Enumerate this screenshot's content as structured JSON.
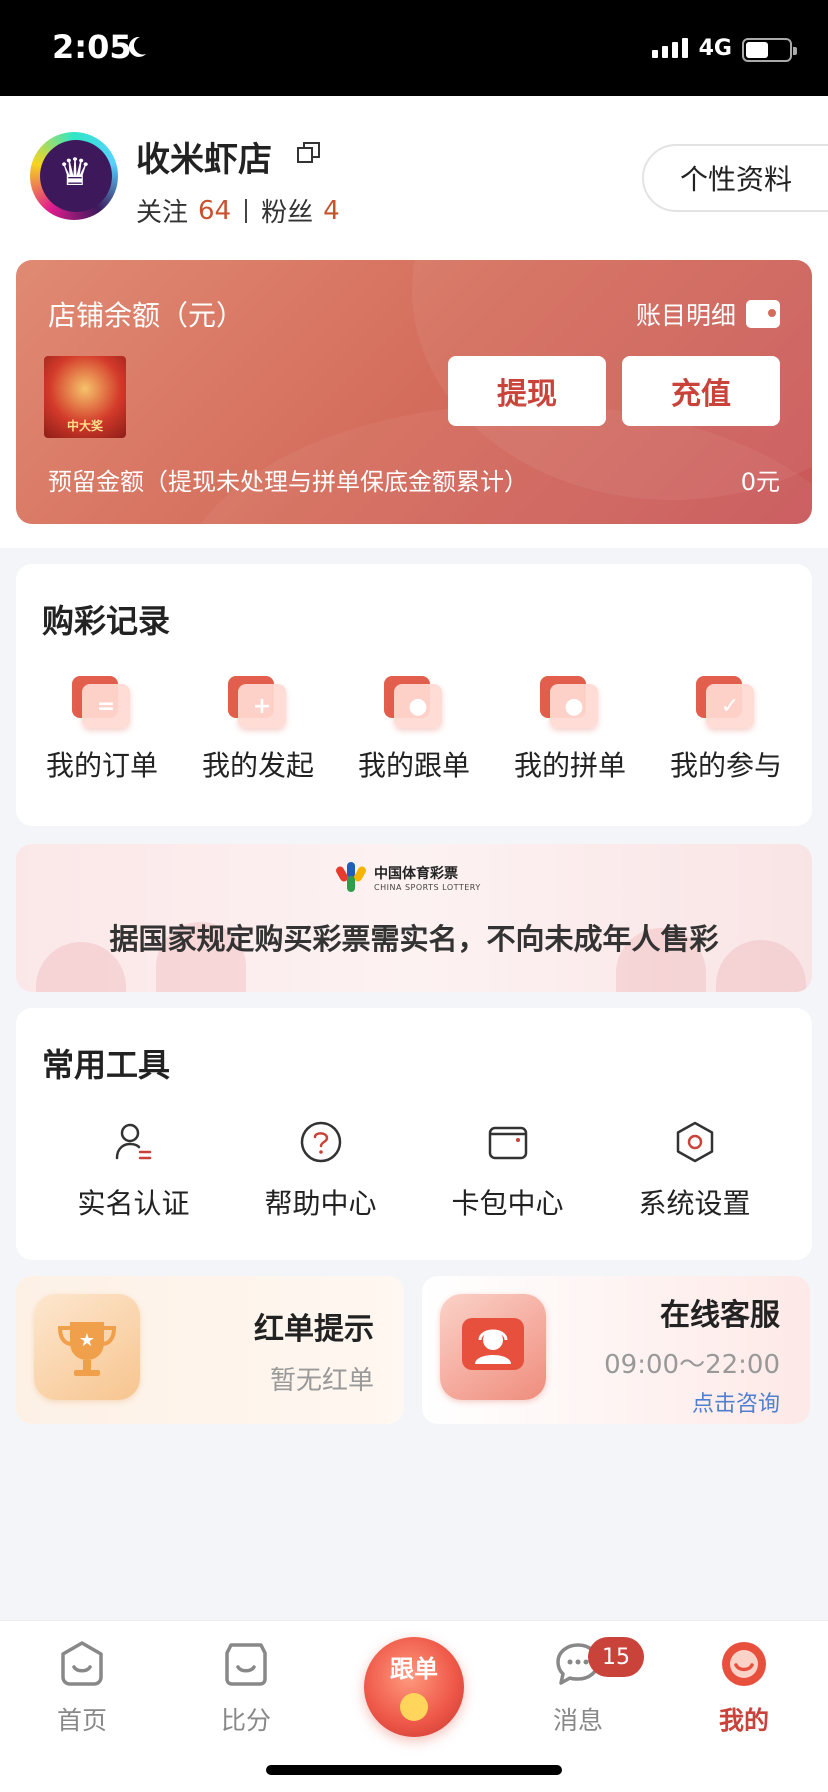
{
  "status_bar": {
    "time": "2:05",
    "network": "4G"
  },
  "profile": {
    "shop_name": "收米虾店",
    "follow_label": "关注",
    "follow_count": "64",
    "fans_label": "粉丝",
    "fans_count": "4",
    "edit_profile_label": "个性资料"
  },
  "balance": {
    "title": "店铺余额（元）",
    "detail_label": "账目明细",
    "thumb_caption": "中大奖",
    "withdraw_label": "提现",
    "recharge_label": "充值",
    "reserve_label": "预留金额（提现未处理与拼单保底金额累计）",
    "reserve_value": "0元"
  },
  "purchase": {
    "title": "购彩记录",
    "items": [
      {
        "label": "我的订单",
        "icon": "order-icon"
      },
      {
        "label": "我的发起",
        "icon": "initiate-icon"
      },
      {
        "label": "我的跟单",
        "icon": "follow-order-icon"
      },
      {
        "label": "我的拼单",
        "icon": "group-order-icon"
      },
      {
        "label": "我的参与",
        "icon": "participate-icon"
      }
    ]
  },
  "lottery_banner": {
    "brand_cn": "中国体育彩票",
    "brand_en": "CHINA SPORTS LOTTERY",
    "notice": "据国家规定购买彩票需实名，不向未成年人售彩"
  },
  "tools": {
    "title": "常用工具",
    "items": [
      {
        "label": "实名认证",
        "icon": "user-verify-icon"
      },
      {
        "label": "帮助中心",
        "icon": "help-icon"
      },
      {
        "label": "卡包中心",
        "icon": "wallet-icon"
      },
      {
        "label": "系统设置",
        "icon": "settings-icon"
      }
    ]
  },
  "red_order": {
    "title": "红单提示",
    "subtitle": "暂无红单"
  },
  "service": {
    "title": "在线客服",
    "hours": "09:00～22:00",
    "link": "点击咨询"
  },
  "tabbar": {
    "home": "首页",
    "score": "比分",
    "follow": "跟单",
    "messages": "消息",
    "messages_badge": "15",
    "mine": "我的"
  },
  "colors": {
    "accent": "#c9433a",
    "card_gradient_start": "#e08a73",
    "card_gradient_end": "#c9575a",
    "link": "#4f7fd1"
  }
}
